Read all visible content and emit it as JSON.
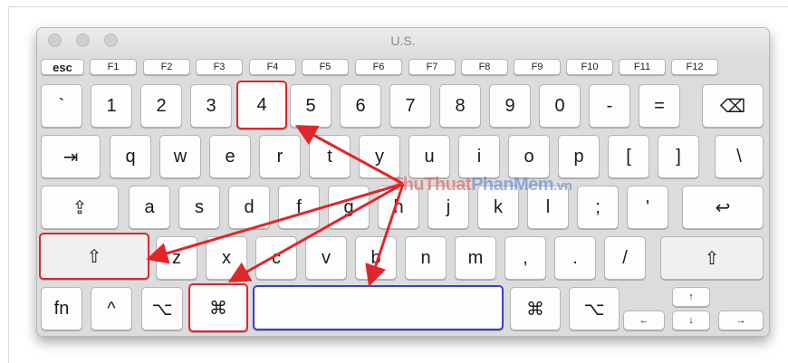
{
  "window": {
    "title": "U.S."
  },
  "function_row": [
    "esc",
    "F1",
    "F2",
    "F3",
    "F4",
    "F5",
    "F6",
    "F7",
    "F8",
    "F9",
    "F10",
    "F11",
    "F12"
  ],
  "row_numbers": [
    "`",
    "1",
    "2",
    "3",
    "4",
    "5",
    "6",
    "7",
    "8",
    "9",
    "0",
    "-",
    "=",
    "⌫"
  ],
  "row_qwerty": [
    "⇥",
    "q",
    "w",
    "e",
    "r",
    "t",
    "y",
    "u",
    "i",
    "o",
    "p",
    "[",
    "]",
    "\\"
  ],
  "row_home": [
    "⇪",
    "a",
    "s",
    "d",
    "f",
    "g",
    "h",
    "j",
    "k",
    "l",
    ";",
    "'",
    "↩"
  ],
  "row_shift": [
    "⇧",
    "z",
    "x",
    "c",
    "v",
    "b",
    "n",
    "m",
    ",",
    ".",
    "/",
    "⇧"
  ],
  "row_bottom": {
    "fn": "fn",
    "control": "^",
    "option_left": "⌥",
    "command_left": "⌘",
    "space": "",
    "command_right": "⌘",
    "option_right": "⌥",
    "arrow_up": "↑",
    "arrow_left": "←",
    "arrow_down": "↓",
    "arrow_right": "→"
  },
  "watermark": {
    "part1": "ThuThuat",
    "part2": "PhanMem",
    "part3": ".vn"
  },
  "colors": {
    "highlight": "#e0262a",
    "spacebar_highlight": "#3c3cd8",
    "arrows": "#e0262a"
  }
}
